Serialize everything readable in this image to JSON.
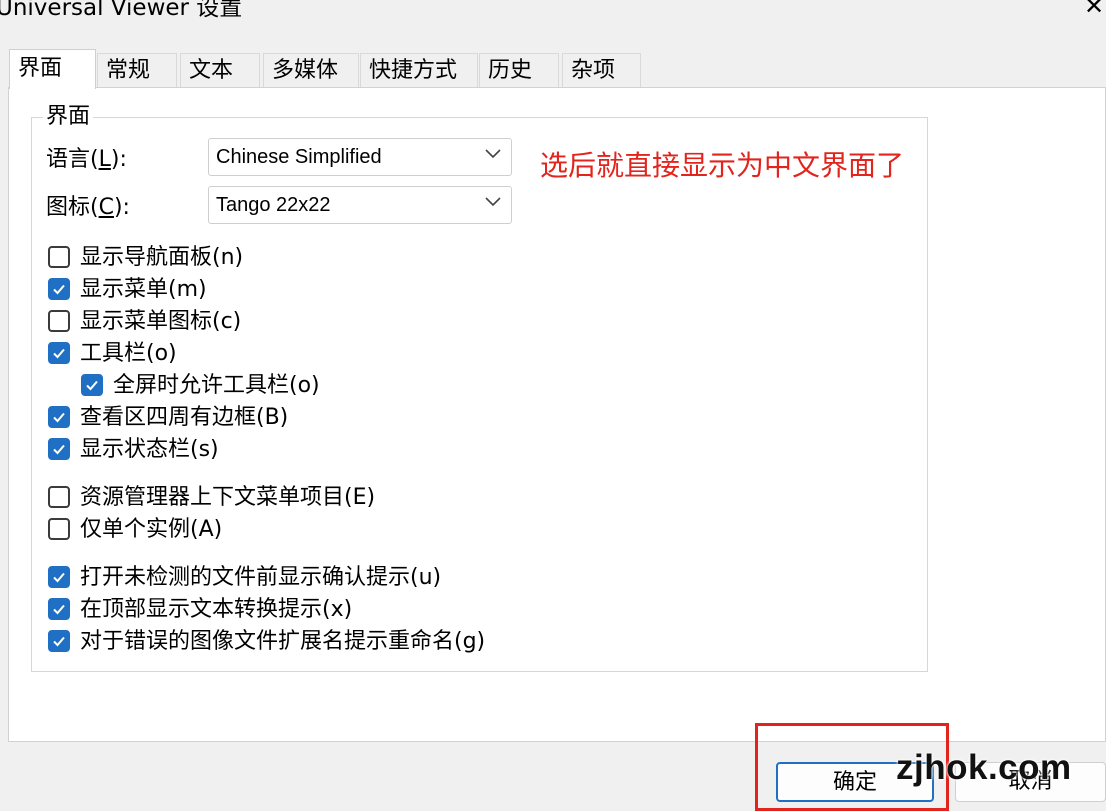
{
  "window": {
    "title": "Universal Viewer 设置",
    "close_label": "✕"
  },
  "tabs": [
    {
      "label": "界面",
      "active": true
    },
    {
      "label": "常规"
    },
    {
      "label": "文本"
    },
    {
      "label": "多媒体"
    },
    {
      "label": "快捷方式"
    },
    {
      "label": "历史"
    },
    {
      "label": "杂项"
    }
  ],
  "group": {
    "title": "界面",
    "language": {
      "label": "语言(",
      "key": "L",
      "suffix": "):",
      "value": "Chinese Simplified"
    },
    "icons": {
      "label": "图标(",
      "key": "C",
      "suffix": "):",
      "value": "Tango 22x22"
    }
  },
  "annotation": "选后就直接显示为中文界面了",
  "checkboxes": [
    {
      "label": "显示导航面板(n)",
      "checked": false
    },
    {
      "label": "显示菜单(m)",
      "checked": true
    },
    {
      "label": "显示菜单图标(c)",
      "checked": false
    },
    {
      "label": "工具栏(o)",
      "checked": true
    },
    {
      "label": "全屏时允许工具栏(o)",
      "checked": true
    },
    {
      "label": "查看区四周有边框(B)",
      "checked": true
    },
    {
      "label": "显示状态栏(s)",
      "checked": true
    },
    {
      "label": "资源管理器上下文菜单项目(E)",
      "checked": false
    },
    {
      "label": "仅单个实例(A)",
      "checked": false
    },
    {
      "label": "打开未检测的文件前显示确认提示(u)",
      "checked": true
    },
    {
      "label": "在顶部显示文本转换提示(x)",
      "checked": true
    },
    {
      "label": "对于错误的图像文件扩展名提示重命名(g)",
      "checked": true
    }
  ],
  "buttons": {
    "ok": "确定",
    "cancel": "取消"
  },
  "watermark": "zjhok.com",
  "colors": {
    "accent": "#1f6fc4",
    "annotation": "#e2241d"
  }
}
